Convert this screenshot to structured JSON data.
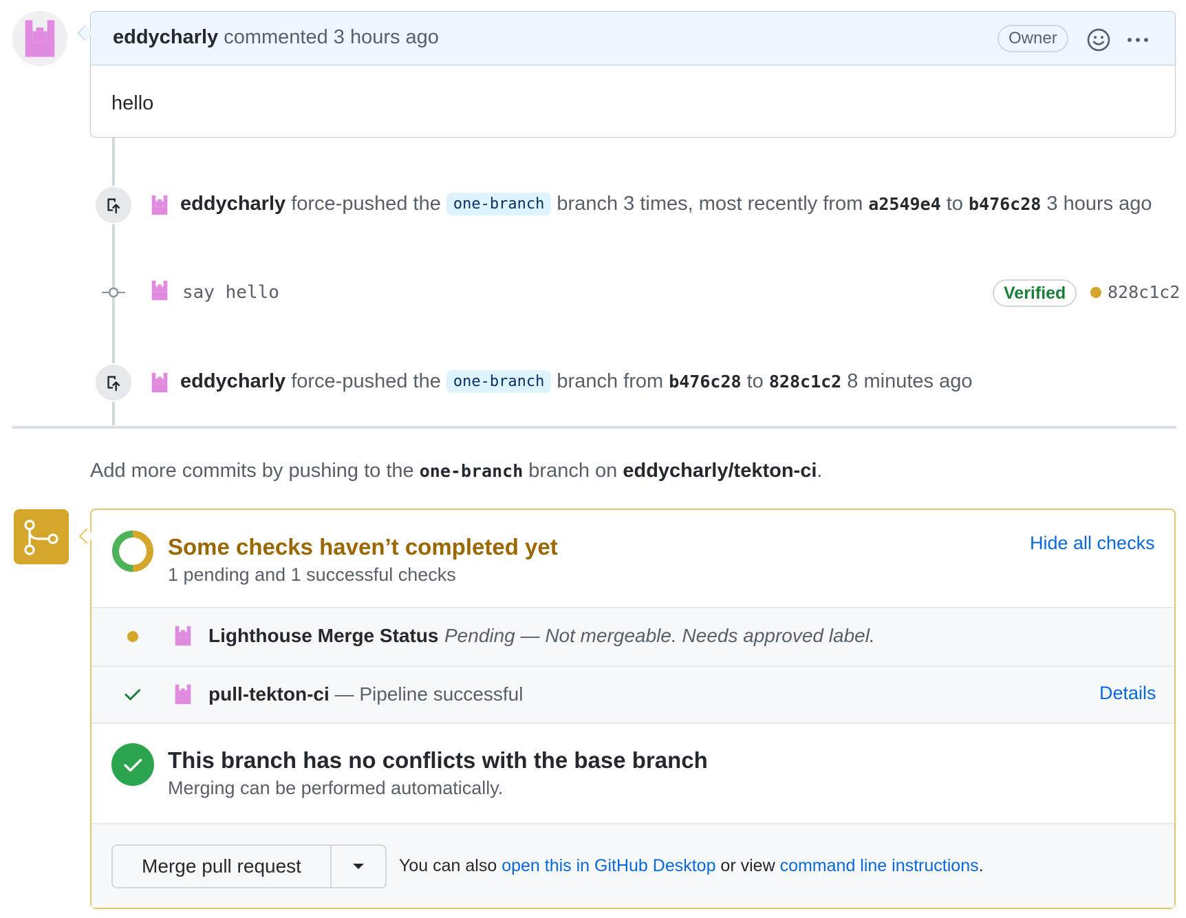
{
  "comment": {
    "author": "eddycharly",
    "action": " commented 3 hours ago",
    "badge": "Owner",
    "body": "hello"
  },
  "events": [
    {
      "author": "eddycharly",
      "pre": " force-pushed the ",
      "branch": "one-branch",
      "mid": " branch 3 times, most recently from ",
      "from_sha": "a2549e4",
      "to_word": " to ",
      "to_sha": "b476c28",
      "time": " 3 hours ago"
    },
    {
      "author": "eddycharly",
      "pre": " force-pushed the ",
      "branch": "one-branch",
      "mid": " branch from ",
      "from_sha": "b476c28",
      "to_word": " to ",
      "to_sha": "828c1c2",
      "time": " 8 minutes ago"
    }
  ],
  "commit": {
    "message": "say hello",
    "verified": "Verified",
    "sha": "828c1c2",
    "status_color": "#d4a72c"
  },
  "push_hint": {
    "pre": "Add more commits by pushing to the ",
    "branch": "one-branch",
    "mid": " branch on ",
    "repo": "eddycharly/tekton-ci",
    "end": "."
  },
  "checks": {
    "title": "Some checks haven’t completed yet",
    "subtitle": "1 pending and 1 successful checks",
    "hide_label": "Hide all checks",
    "items": [
      {
        "name": "Lighthouse Merge Status",
        "desc": "Pending — Not mergeable. Needs approved label.",
        "status": "pending"
      },
      {
        "name": "pull-tekton-ci",
        "desc": " — Pipeline successful",
        "status": "success",
        "details": "Details"
      }
    ]
  },
  "conflicts": {
    "title": "This branch has no conflicts with the base branch",
    "subtitle": "Merging can be performed automatically."
  },
  "merge": {
    "button": "Merge pull request",
    "alt_pre": "You can also ",
    "desktop_link": "open this in GitHub Desktop",
    "alt_mid": " or view ",
    "cli_link": "command line instructions",
    "alt_end": "."
  },
  "colors": {
    "pending": "#d4a72c",
    "success": "#2da44e",
    "link": "#0969da",
    "identicon": "#e08be0"
  }
}
